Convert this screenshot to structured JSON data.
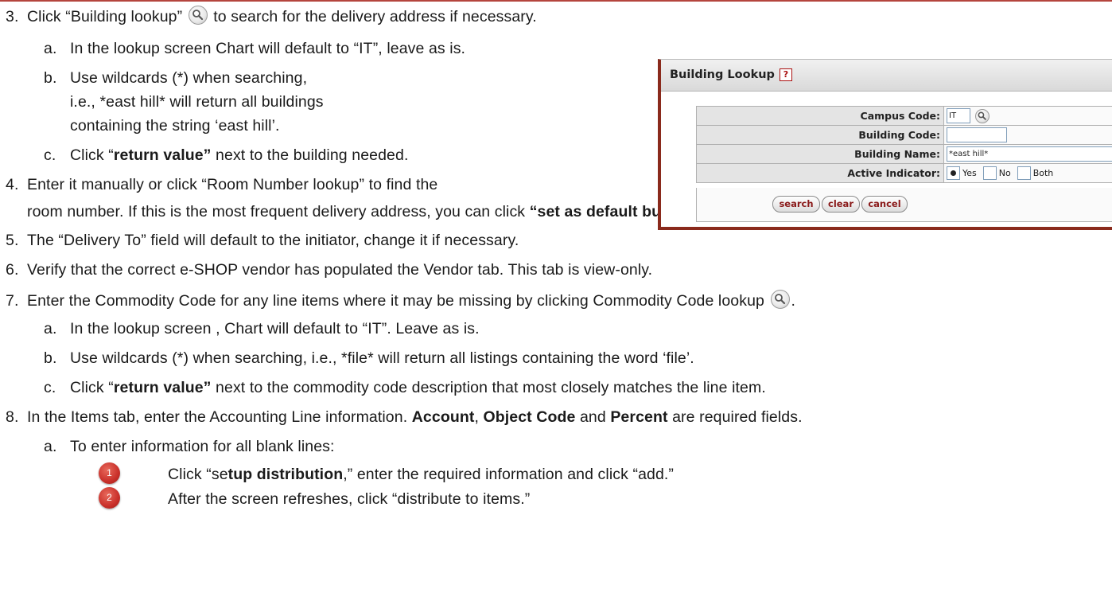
{
  "lines": {
    "l3": {
      "num": "3.",
      "text_a": "Click “Building lookup”",
      "text_b": " to search for the delivery address if necessary."
    },
    "l3a": {
      "num": "a.",
      "text": "In the lookup screen Chart will default to “IT”, leave as is."
    },
    "l3b": {
      "num": "b.",
      "text": "Use wildcards (*) when searching,"
    },
    "l3b2": {
      "text": "i.e., *east hill* will return all buildings"
    },
    "l3b3": {
      "text": "containing the string ‘east hill’."
    },
    "l3c": {
      "num": "c.",
      "pre": "Click “",
      "bold": "return value”",
      "post": " next to the building needed."
    },
    "l4": {
      "num": "4.",
      "text": "Enter it manually or click “Room Number lookup” to find the"
    },
    "l4b": {
      "pre": " room number. If this is the most frequent delivery address, you can click ",
      "bold": "“set as default building.”"
    },
    "l5": {
      "num": "5.",
      "text": "The “Delivery To” field will default to the initiator, change it if necessary."
    },
    "l6": {
      "num": "6.",
      "text": "Verify that the correct e-SHOP vendor has populated the Vendor tab. This tab is view-only."
    },
    "l7": {
      "num": "7.",
      "text": "Enter the Commodity Code for any line items where it may be missing by clicking Commodity Code lookup",
      "post": "."
    },
    "l7a": {
      "num": "a.",
      "text": "In the lookup screen , Chart will default to “IT”. Leave as is."
    },
    "l7b": {
      "num": "b.",
      "text": "Use wildcards (*) when searching, i.e., *file* will return all listings containing the word ‘file’."
    },
    "l7c": {
      "num": "c.",
      "pre": "Click “",
      "bold": "return value”",
      "post": " next to the commodity code description that most closely matches the line item."
    },
    "l8": {
      "num": "8.",
      "pre": "In the Items tab, enter the Accounting Line information.  ",
      "b1": "Account",
      "m1": ", ",
      "b2": "Object Code",
      "m2": " and ",
      "b3": "Percent",
      "post": " are required fields."
    },
    "l8a": {
      "num": "a.",
      "text": "To enter information for all blank lines:"
    },
    "s1": {
      "badge": "1",
      "pre": "Click “se",
      "bold": "tup distribution",
      "post": ",” enter the required information and click “add.”"
    },
    "s2": {
      "badge": "2",
      "text": "After the screen refreshes, click “distribute to items.”"
    }
  },
  "lookup_panel": {
    "title": "Building Lookup",
    "help": "?",
    "fields": [
      {
        "label": "Campus Code:",
        "value": "IT"
      },
      {
        "label": "Building Code:",
        "value": ""
      },
      {
        "label": "Building Name:",
        "value": "*east hill*"
      },
      {
        "label": "Active Indicator:",
        "options": [
          "Yes",
          "No",
          "Both"
        ],
        "selected": "Yes"
      }
    ],
    "buttons": [
      "search",
      "clear",
      "cancel"
    ]
  }
}
